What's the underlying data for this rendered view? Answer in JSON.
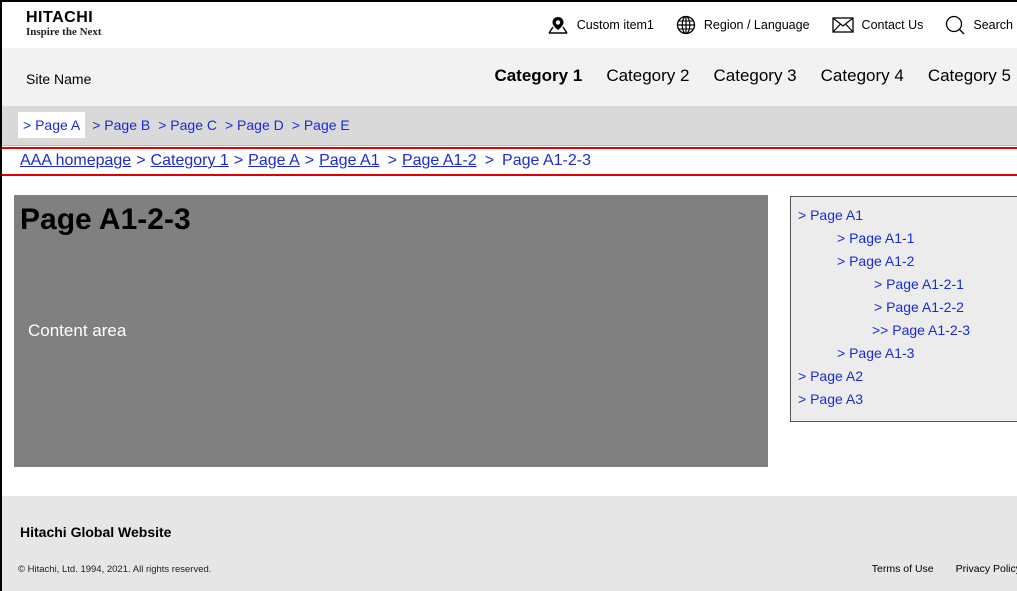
{
  "header": {
    "brand": "HITACHI",
    "tagline": "Inspire the Next",
    "utilities": [
      {
        "label": "Custom item1",
        "icon": "map-pin-icon"
      },
      {
        "label": "Region / Language",
        "icon": "globe-icon"
      },
      {
        "label": "Contact Us",
        "icon": "envelope-icon"
      },
      {
        "label": "Search",
        "icon": "search-icon"
      }
    ]
  },
  "global_nav": {
    "site_name": "Site Name",
    "categories": [
      "Category 1",
      "Category 2",
      "Category 3",
      "Category 4",
      "Category 5"
    ],
    "active_category": "Category 1"
  },
  "local_nav": {
    "items": [
      "> Page A",
      "> Page B",
      "> Page C",
      "> Page D",
      "> Page E"
    ],
    "current": "> Page A"
  },
  "breadcrumb": {
    "links": [
      "AAA homepage",
      "Category 1",
      "Page A",
      "Page A1",
      "Page A1-2"
    ],
    "separator": ">",
    "current": "Page A1-2-3"
  },
  "content": {
    "title": "Page A1-2-3",
    "placeholder": "Content area"
  },
  "side_nav": {
    "items": [
      "> Page A1",
      "> Page A1-1",
      "> Page A1-2",
      "> Page A1-2-1",
      "> Page A1-2-2",
      ">> Page A1-2-3",
      "> Page A1-3",
      "> Page A2",
      "> Page A3"
    ]
  },
  "footer": {
    "title": "Hitachi Global Website",
    "copyright": "© Hitachi, Ltd. 1994, 2021. All rights reserved.",
    "links": [
      "Terms of Use",
      "Privacy Policy"
    ]
  },
  "colors": {
    "link": "#1a2bd6",
    "breadcrumb_rule": "#e00000",
    "content_bg": "#808080",
    "nav_bg": "#f2f2f2",
    "local_nav_bg": "#d9d9d9"
  }
}
